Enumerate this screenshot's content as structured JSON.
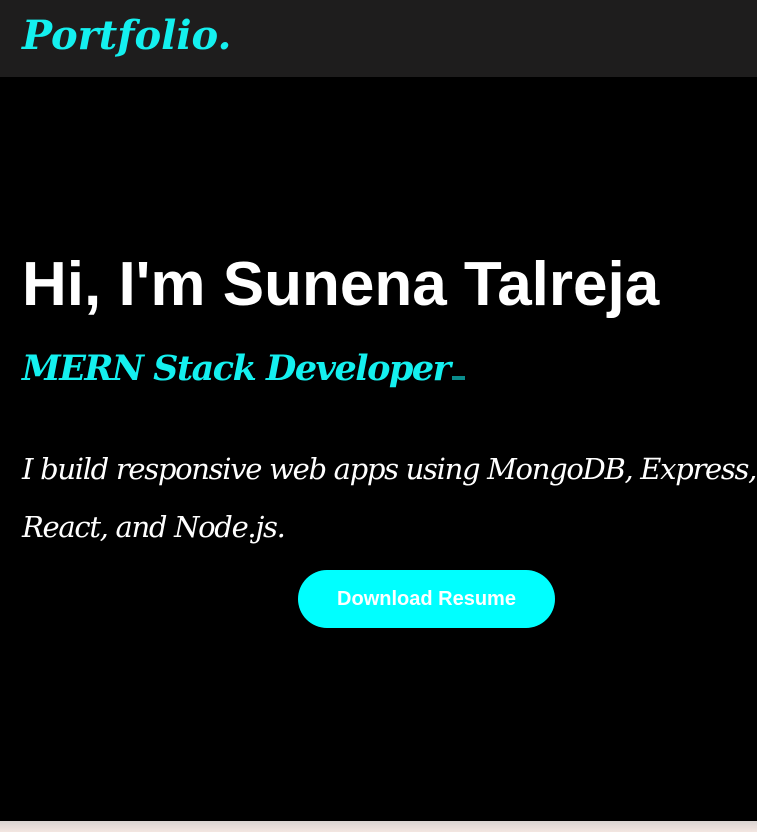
{
  "navbar": {
    "brand": "Portfolio."
  },
  "hero": {
    "title": "Hi, I'm Sunena Talreja",
    "role": "MERN Stack Developer",
    "description": "I build responsive web apps using MongoDB, Express, React, and Node.js.",
    "resume_button": "Download Resume"
  },
  "colors": {
    "accent": "#00ffff",
    "navbar_background": "#1e1d1d",
    "page_background": "#000000",
    "text": "#ffffff"
  }
}
